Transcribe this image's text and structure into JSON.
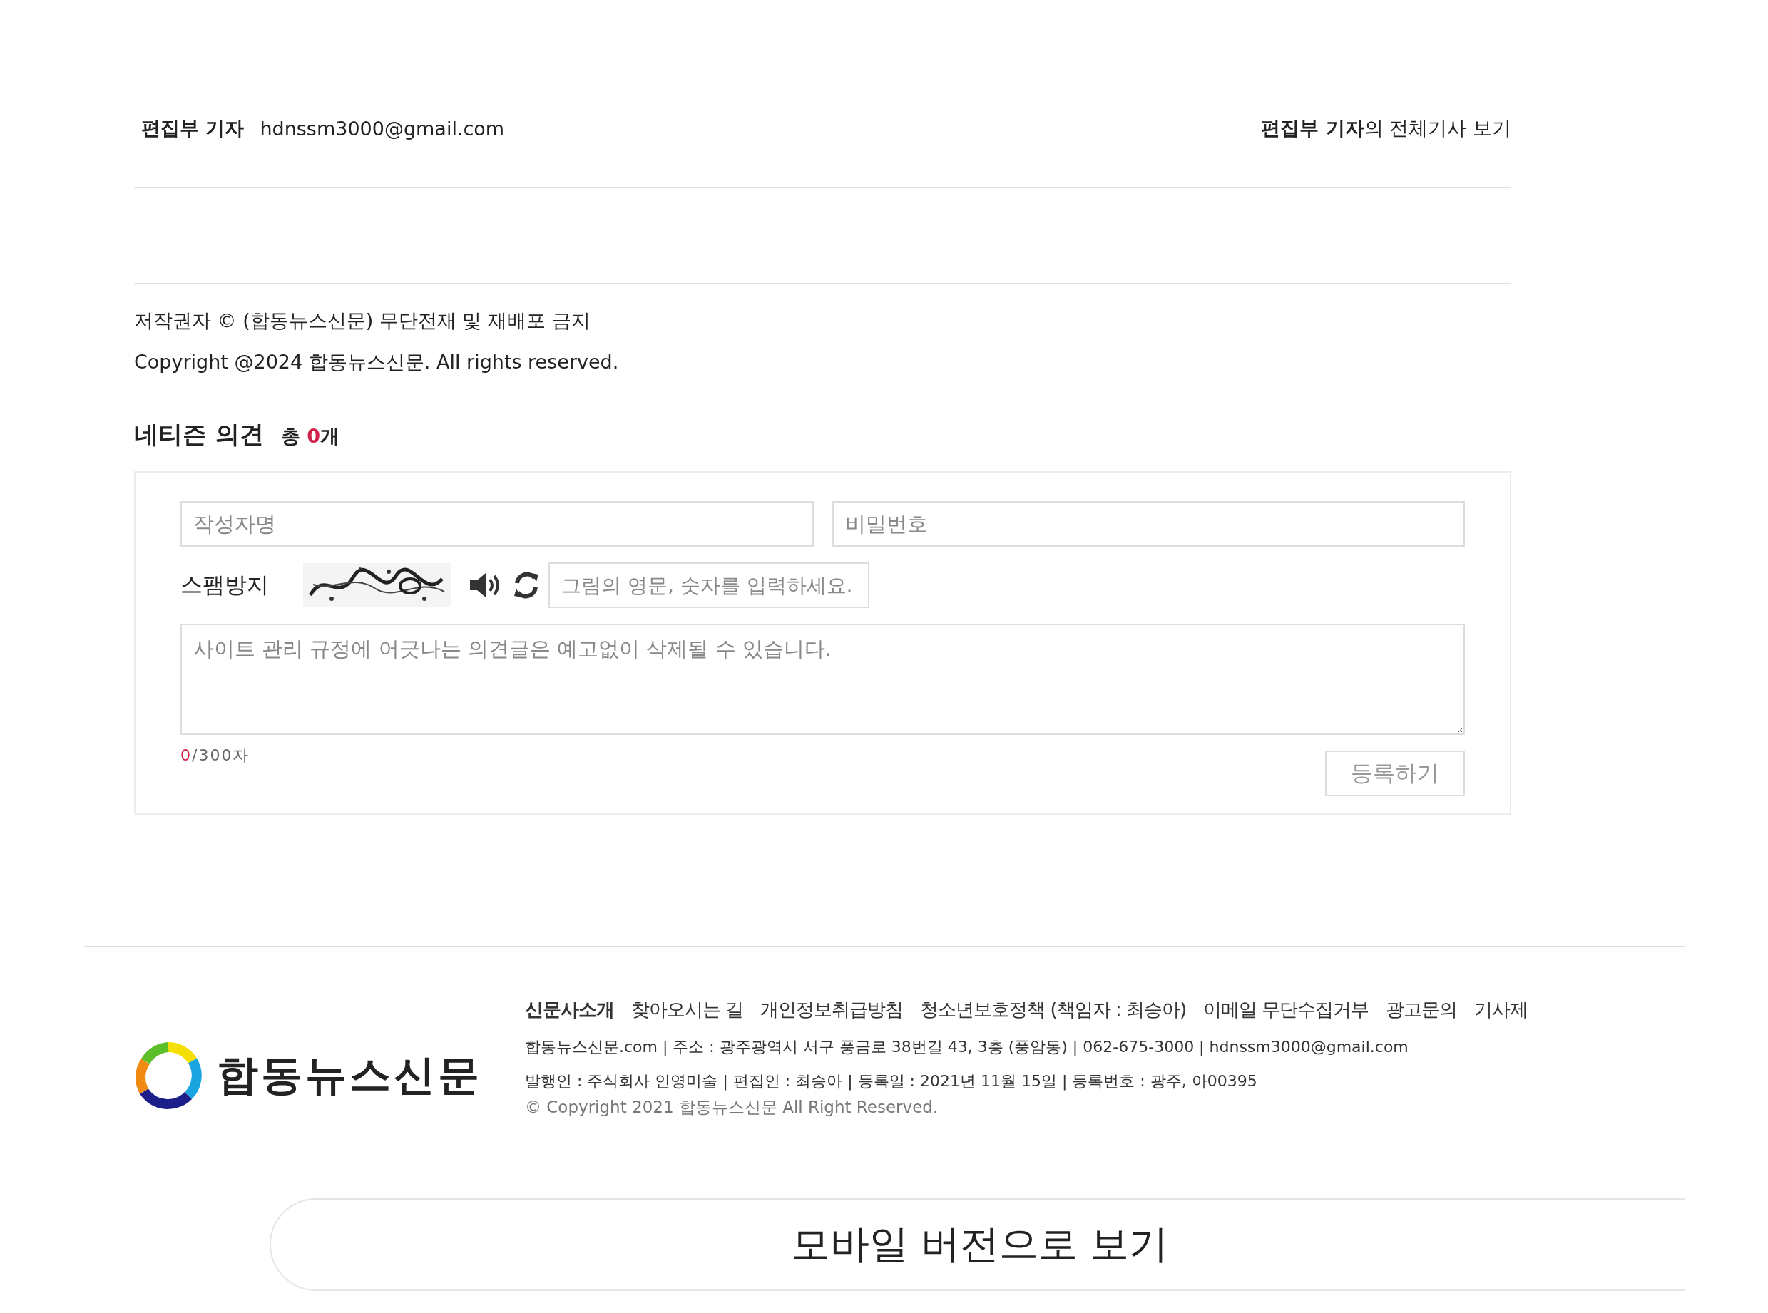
{
  "byline": {
    "name": "편집부 기자",
    "email": "hdnssm3000@gmail.com",
    "all_articles": "**편집부 기자**의 전체기사 보기"
  },
  "copyright": {
    "notice": "저작권자 © (합동뉴스신문) 무단전재 및 재배포 금지",
    "line": "Copyright @2024 합동뉴스신문. All rights reserved."
  },
  "comments": {
    "title": "네티즌 의견",
    "count_prefix": "총",
    "count": "0",
    "count_suffix": "개",
    "author_field": {
      "placeholder": "작성자명"
    },
    "password_field": {
      "placeholder": "비밀번호"
    },
    "spam_label": "스팸방지",
    "captcha_field": {
      "placeholder": "그림의 영문, 숫자를 입력하세요."
    },
    "comment_field": {
      "placeholder": "사이트 관리 규정에 어긋나는 의견글은 예고없이 삭제될 수 있습니다."
    },
    "char_count": "0",
    "char_limit": "/300자",
    "submit": "등록하기"
  },
  "footer": {
    "logo_text": "합동뉴스신문",
    "links": [
      {
        "label": "신문사소개",
        "selected": true
      },
      {
        "label": "찾아오시는 길",
        "selected": false
      },
      {
        "label": "개인정보취급방침",
        "selected": false
      },
      {
        "label": "청소년보호정책 (책임자 : 최승아)",
        "selected": false
      },
      {
        "label": "이메일 무단수집거부",
        "selected": false
      },
      {
        "label": "광고문의",
        "selected": false
      },
      {
        "label": "기사제",
        "selected": false
      }
    ],
    "info": [
      "합동뉴스신문.com | 주소 : 광주광역시 서구 풍금로 38번길 43, 3층 (풍암동) | 062-675-3000 | hdnssm3000@gmail.com",
      "발행인 : 주식회사 인영미술 | 편집인 : 최승아 | 등록일 : 2021년 11월 15일 | 등록번호 : 광주, 아00395"
    ],
    "copyright": "© Copyright 2021 합동뉴스신문 All Right Reserved."
  },
  "mobile_button": "모바일 버전으로 보기"
}
